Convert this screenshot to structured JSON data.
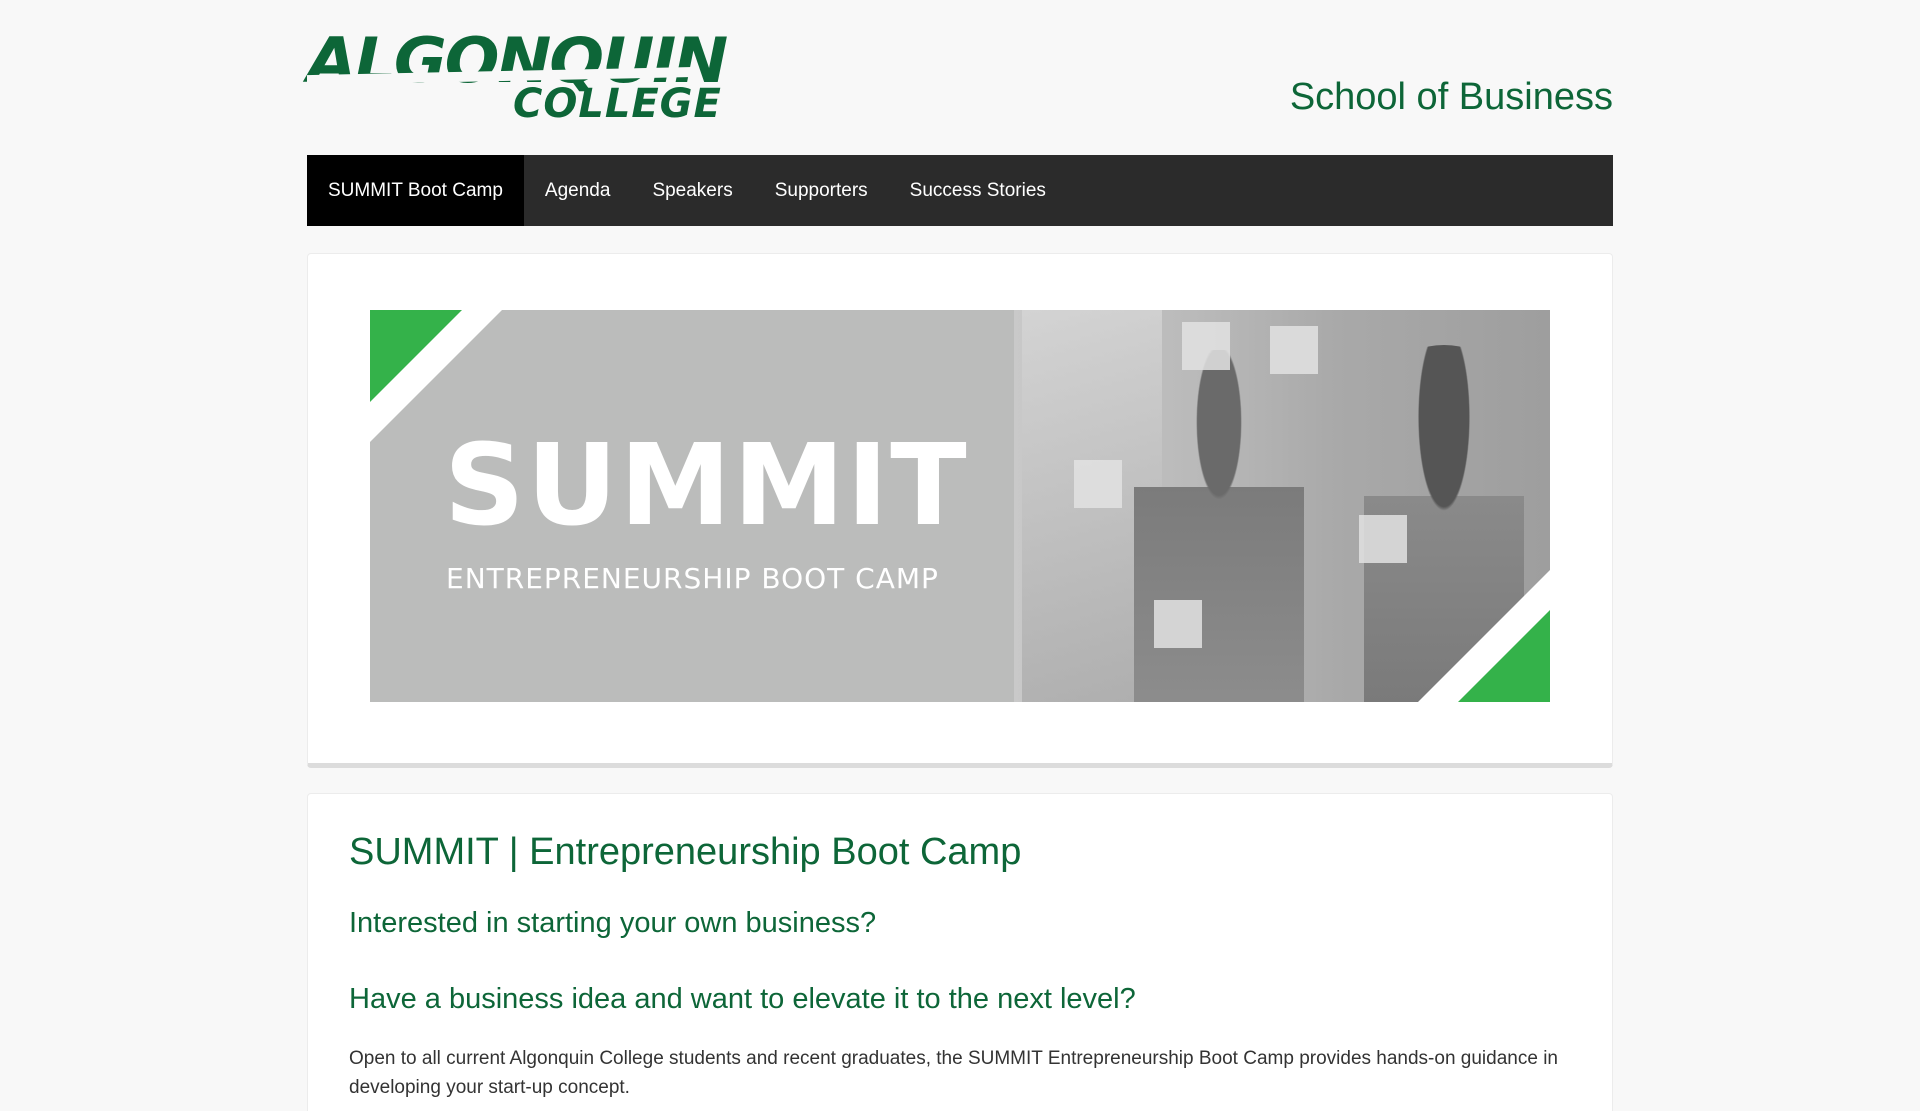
{
  "brand": {
    "logo_line1": "ALGONQUIN",
    "logo_line2": "COLLEGE",
    "school": "School of Business"
  },
  "nav": {
    "items": [
      {
        "label": "SUMMIT Boot Camp",
        "active": true
      },
      {
        "label": "Agenda"
      },
      {
        "label": "Speakers"
      },
      {
        "label": "Supporters"
      },
      {
        "label": "Success Stories"
      }
    ]
  },
  "banner": {
    "title": "SUMMIT",
    "subtitle": "ENTREPRENEURSHIP BOOT CAMP",
    "accent_color": "#34b24a"
  },
  "content": {
    "heading": "SUMMIT | Entrepreneurship Boot Camp",
    "question1": "Interested in starting your own business?",
    "question2": "Have a business idea and want to elevate it to the next level?",
    "paragraph": "Open to all current Algonquin College students and recent graduates, the SUMMIT Entrepreneurship Boot Camp provides hands-on guidance in developing your start-up concept."
  },
  "colors": {
    "brand_green": "#0d6638",
    "nav_bg": "#2b2b2b",
    "nav_active_bg": "#000000"
  }
}
